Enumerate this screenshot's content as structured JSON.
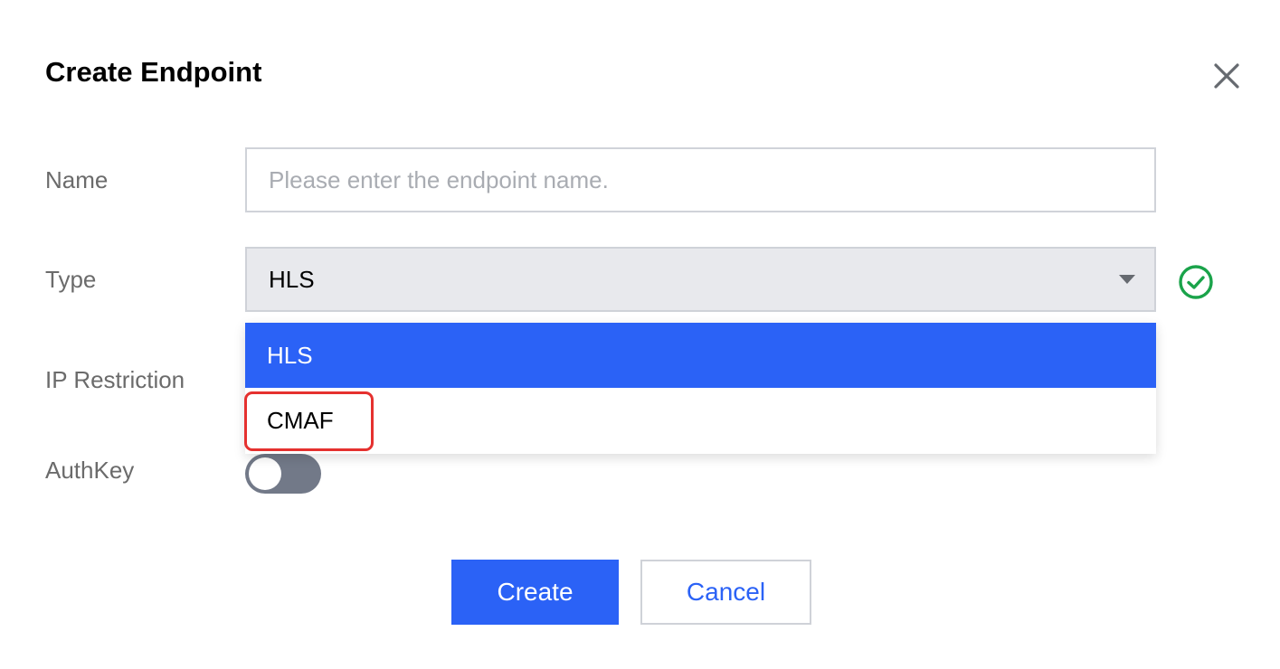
{
  "dialog": {
    "title": "Create Endpoint"
  },
  "form": {
    "name": {
      "label": "Name",
      "value": "",
      "placeholder": "Please enter the endpoint name."
    },
    "type": {
      "label": "Type",
      "selected": "HLS",
      "options": [
        "HLS",
        "CMAF"
      ],
      "status_icon": "check-circle-icon"
    },
    "ip_restriction": {
      "label": "IP Restriction"
    },
    "authkey": {
      "label": "AuthKey",
      "enabled": false
    }
  },
  "actions": {
    "create_label": "Create",
    "cancel_label": "Cancel"
  },
  "colors": {
    "accent": "#2b62f6",
    "success": "#1aa34a",
    "highlight_border": "#e5312f",
    "toggle_off": "#727988"
  }
}
